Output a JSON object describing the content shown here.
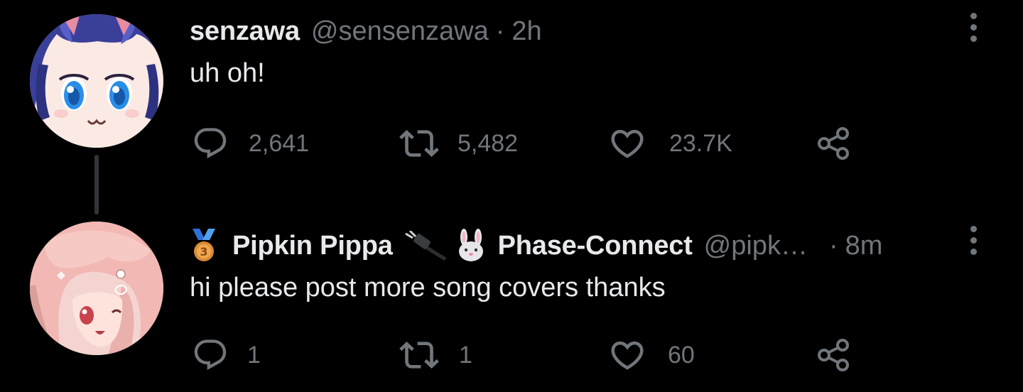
{
  "colors": {
    "background": "#000000",
    "primary_text": "#e7e9ea",
    "secondary_text": "#71767b",
    "thread_line": "#333639"
  },
  "tweets": [
    {
      "display_name": "senzawa",
      "handle": "@sensenzawa",
      "separator": "·",
      "time": "2h",
      "text": "uh oh!",
      "avatar": "anime-avatar-blue-hair",
      "reply_count": "2,641",
      "retweet_count": "5,482",
      "like_count": "23.7K",
      "icons": [
        "reply-icon",
        "retweet-icon",
        "like-icon",
        "share-icon",
        "more-icon"
      ]
    },
    {
      "badge": "medal-3-icon",
      "display_name": "Pipkin Pippa",
      "name_emojis": [
        "plug-icon",
        "rabbit-icon"
      ],
      "affiliation": "Phase-Connect",
      "handle": "@pipk…",
      "separator": "·",
      "time": "8m",
      "text": "hi please post more song covers thanks",
      "avatar": "anime-avatar-pink-hair",
      "reply_count": "1",
      "retweet_count": "1",
      "like_count": "60",
      "icons": [
        "reply-icon",
        "retweet-icon",
        "like-icon",
        "share-icon",
        "more-icon"
      ]
    }
  ]
}
